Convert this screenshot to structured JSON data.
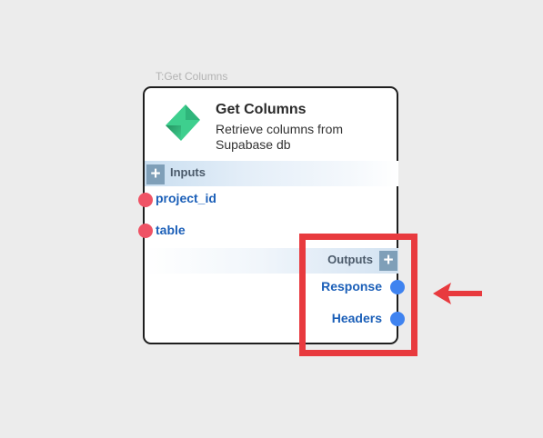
{
  "node": {
    "tag": "T:Get Columns",
    "title": "Get Columns",
    "description": "Retrieve columns from Supabase db",
    "logo_icon": "supabase-logo-icon"
  },
  "inputs": {
    "label": "Inputs",
    "add_symbol": "+",
    "ports": [
      {
        "label": "project_id"
      },
      {
        "label": "table"
      }
    ]
  },
  "outputs": {
    "label": "Outputs",
    "add_symbol": "+",
    "ports": [
      {
        "label": "Response"
      },
      {
        "label": "Headers"
      }
    ]
  },
  "annotation": {
    "highlight_color": "#e83a3e",
    "arrow_icon": "left-arrow-icon"
  },
  "colors": {
    "input_port": "#ef5365",
    "output_port": "#3f83f0",
    "port_label": "#1b5fb8",
    "logo_green": "#3ecf8e"
  }
}
